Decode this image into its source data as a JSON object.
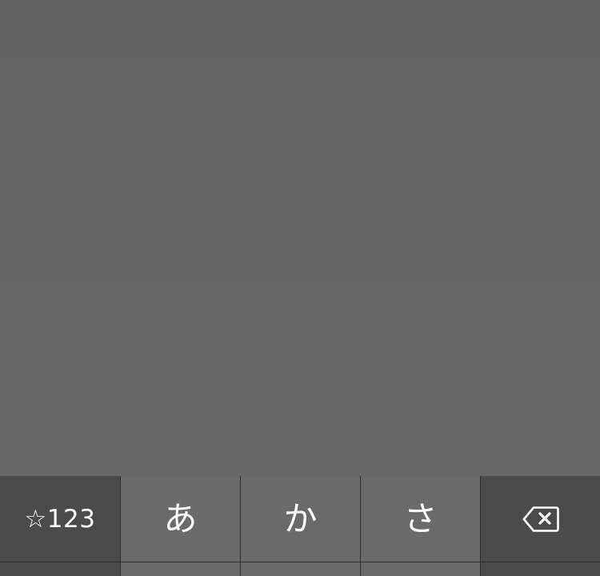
{
  "keyboard": {
    "row1": {
      "symbols_label": "☆123",
      "kana_keys": [
        "あ",
        "か",
        "さ"
      ],
      "delete_icon": "backspace-icon"
    }
  },
  "colors": {
    "background": "#666666",
    "dark_key": "#4b4b4b",
    "light_key": "#6a6a6a",
    "key_text": "#ffffff",
    "key_gap": "#2d2d2d"
  }
}
